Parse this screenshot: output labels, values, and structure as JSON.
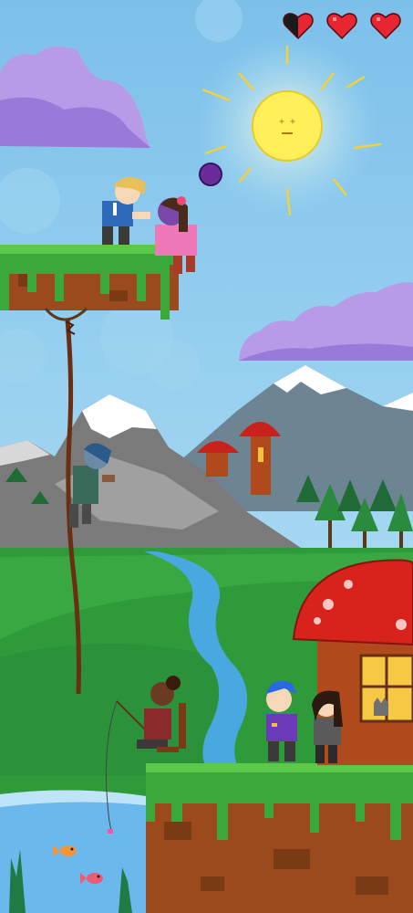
{
  "hud": {
    "health": {
      "current": 2.5,
      "max": 3
    },
    "hearts": [
      {
        "state": "half"
      },
      {
        "state": "full"
      },
      {
        "state": "full"
      }
    ]
  },
  "colors": {
    "sky": "#8cc8ea",
    "heart_red": "#e82632",
    "heart_dark": "#1a1a1a",
    "sun": "#fff05a",
    "grass": "#3aa83a",
    "dirt": "#9a4a1c",
    "mushroom_cap": "#d8221c",
    "cloud": "#b79be8",
    "river": "#4aa8e0",
    "water": "#6ab8ec"
  }
}
